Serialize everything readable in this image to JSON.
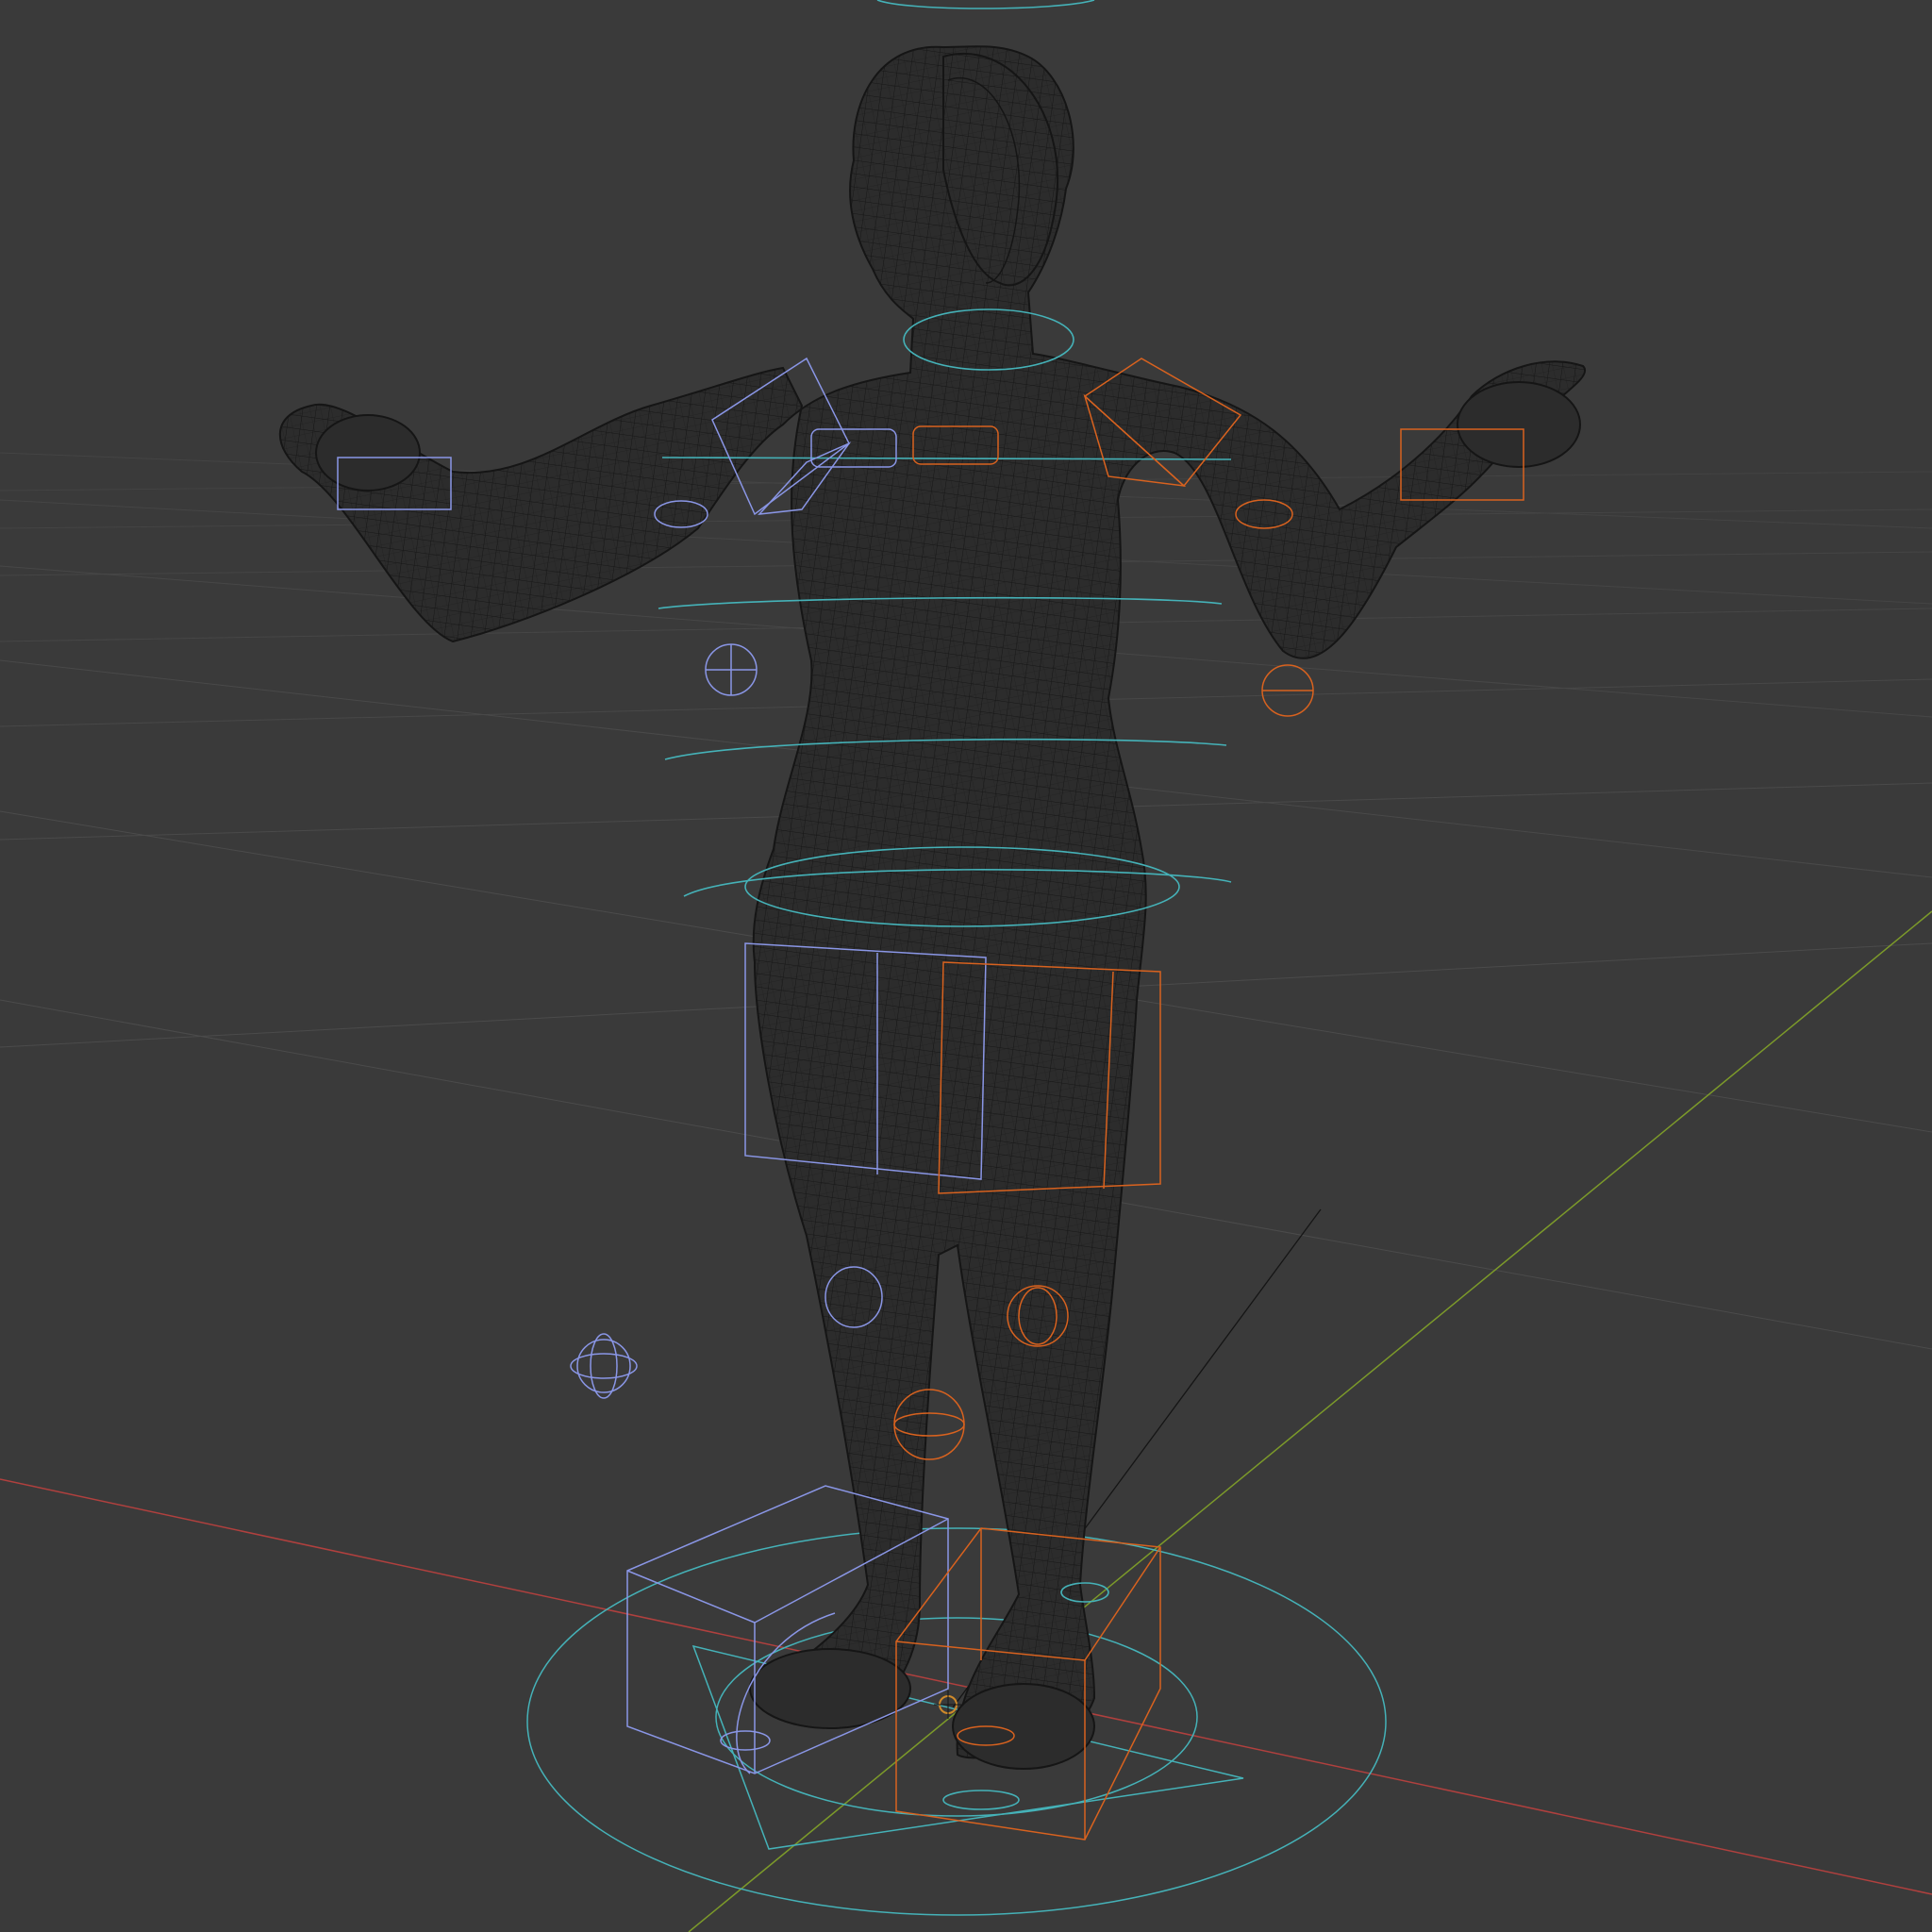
{
  "viewport": {
    "mode": "wireframe",
    "background": "#3a3a3a"
  },
  "scene": {
    "object": "character-mesh",
    "overlays": [
      "floor-grid",
      "x-axis",
      "y-axis",
      "armature-controls"
    ]
  },
  "colors": {
    "background": "#3a3a3a",
    "grid_line": "#4a4a4a",
    "x_axis": "#b0403e",
    "y_axis": "#7c9a2a",
    "mesh_wire": "#151515",
    "mesh_fill": "#2c2c2c",
    "control_center": "#45b2b8",
    "control_left": "#8a96e6",
    "control_right": "#d8621f"
  }
}
